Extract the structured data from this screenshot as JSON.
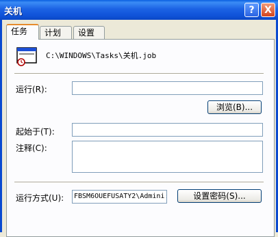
{
  "window": {
    "title": "关机"
  },
  "title_buttons": {
    "help": "?",
    "close": "X"
  },
  "tabs": [
    {
      "label": "任务"
    },
    {
      "label": "计划"
    },
    {
      "label": "设置"
    }
  ],
  "task": {
    "path": "C:\\WINDOWS\\Tasks\\关机.job",
    "run_label": "运行(R):",
    "run_value": "",
    "browse_button": "浏览(B)...",
    "start_in_label": "起始于(T):",
    "start_in_value": "",
    "comment_label": "注释(C):",
    "comment_value": "",
    "run_as_label": "运行方式(U):",
    "run_as_value": "FBSM6OUEFUSATY2\\Admini:",
    "set_password_button": "设置密码(S)..."
  },
  "icons": {
    "job": "scheduled-task-icon"
  }
}
